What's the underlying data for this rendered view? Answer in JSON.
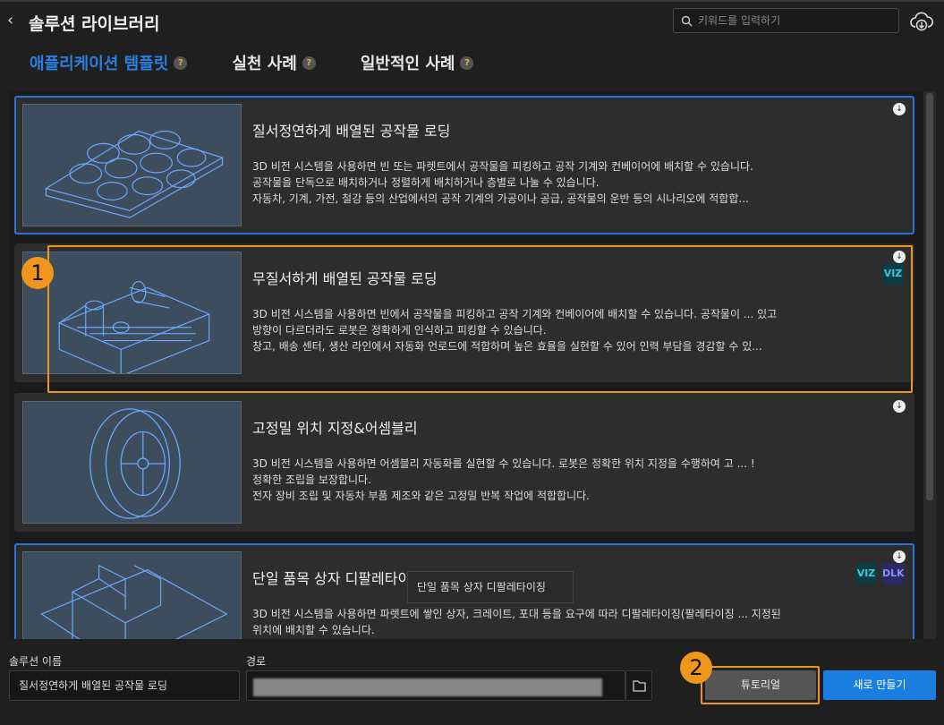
{
  "header": {
    "back_icon": "chevron-left-icon",
    "title": "솔루션 라이브러리",
    "search_placeholder": "키워드를 입력하기",
    "download_icon": "cloud-download-icon"
  },
  "tabs": [
    {
      "label": "애플리케이션 템플릿",
      "active": true
    },
    {
      "label": "실천 사례"
    },
    {
      "label": "일반적인 사례"
    }
  ],
  "help_glyph": "?",
  "cards": [
    {
      "title": "질서정연하게 배열된 공작물 로딩",
      "lines": [
        "3D 비전 시스템을 사용하면 빈 또는 파렛트에서 공작물을 피킹하고 공작 기계와 컨베이어에 배치할 수 있습니다.",
        "공작물을 단독으로 배치하거나 정렬하게 배치하거나 층별로 나눌 수 있습니다.",
        "자동차, 기계, 가전, 철강 등의 산업에서의 공작 기계의 가공이나 공급, 공작물의 운반 등의 시나리오에 적합합..."
      ],
      "badges": []
    },
    {
      "title": "무질서하게 배열된 공작물 로딩",
      "lines": [
        "3D 비전 시스템을 사용하면 빈에서 공작물을 피킹하고 공작 기계와 컨베이어에 배치할 수 있습니다. 공작물이 ... 있고",
        "방향이 다르더라도 로봇은 정확하게 인식하고 피킹할 수 있습니다.",
        "창고, 배송 센터, 생산 라인에서 자동화 언로드에 적합하며 높은 효율을 실현할 수 있어 인력 부담을 경감할 수 있..."
      ],
      "badges": [
        "VIZ"
      ]
    },
    {
      "title": "고정밀 위치 지정&어셈블리",
      "lines": [
        "3D 비전 시스템을 사용하면 어셈블리 자동화를 실현할 수 있습니다. 로봇은 정확한 위치 지정을 수행하여 고 ... !",
        "정확한 조립을 보장합니다.",
        "전자 장비 조립 및 자동차 부품 제조와 같은 고정밀 반복 작업에 적합합니다."
      ],
      "badges": []
    },
    {
      "title": "단일 품목 상자 디팔레타이징",
      "lines": [
        "3D 비전 시스템을 사용하면 파렛트에 쌓인 상자, 크레이트, 포대 등을 요구에 따라 디팔레타이징(팔레타이징 ... 지정된",
        "위치에 배치할 수 있습니다."
      ],
      "badges": [
        "VIZ",
        "DLK"
      ]
    }
  ],
  "tooltip": "단일 품목 상자 디팔레타이징",
  "bottom": {
    "name_label": "솔루션 이름",
    "name_value": "질서정연하게 배열된 공작물 로딩",
    "path_label": "경로",
    "tutorial": "튜토리얼",
    "create": "새로 만들기"
  },
  "annotations": [
    "1",
    "2"
  ],
  "colors": {
    "accent": "#2a7fe0",
    "highlight": "#f0961c"
  }
}
